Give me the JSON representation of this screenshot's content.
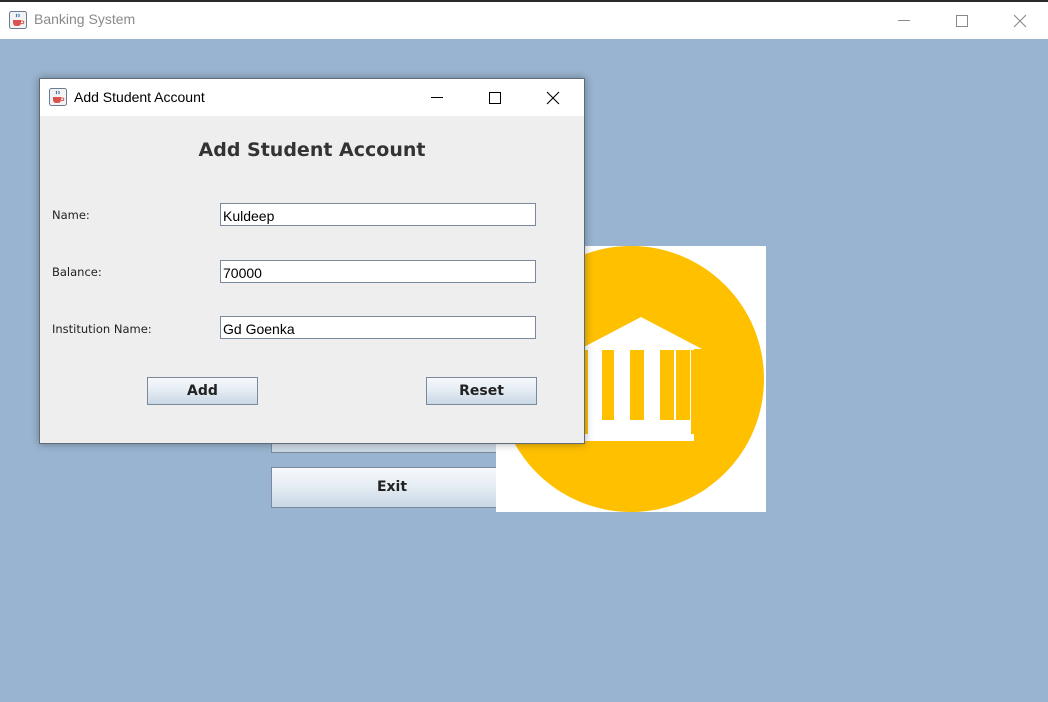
{
  "main_window": {
    "title": "Banking System",
    "buttons": {
      "exit_label": "Exit"
    }
  },
  "dialog": {
    "title": "Add Student Account",
    "heading": "Add Student Account",
    "fields": [
      {
        "label": "Name:",
        "value": "Kuldeep"
      },
      {
        "label": "Balance:",
        "value": "70000"
      },
      {
        "label": "Institution Name:",
        "value": "Gd Goenka"
      }
    ],
    "add_label": "Add",
    "reset_label": "Reset"
  },
  "icons": {
    "app": "java-coffee-icon",
    "minimize": "minimize-icon",
    "maximize": "maximize-icon",
    "close": "close-icon",
    "logo": "bank-building-icon"
  },
  "colors": {
    "desktop_bg": "#99b4d1",
    "logo_circle": "#ffc000",
    "dialog_bg": "#eeeeee"
  }
}
